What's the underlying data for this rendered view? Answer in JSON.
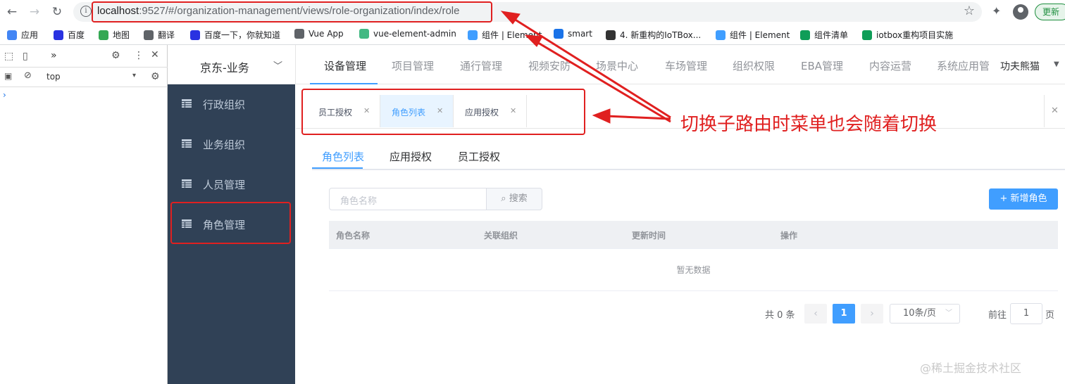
{
  "browser": {
    "url_host": "localhost",
    "url_path": ":9527/#/organization-management/views/role-organization/index/role",
    "update_label": "更新",
    "bookmarks": [
      {
        "label": "应用",
        "color": "#4285f4"
      },
      {
        "label": "百度",
        "color": "#2932e1"
      },
      {
        "label": "地图",
        "color": "#34a853"
      },
      {
        "label": "翻译",
        "color": "#5f6368"
      },
      {
        "label": "百度一下，你就知道",
        "color": "#2932e1"
      },
      {
        "label": "Vue App",
        "color": "#5f6368"
      },
      {
        "label": "vue-element-admin",
        "color": "#42b983"
      },
      {
        "label": "组件 | Element",
        "color": "#409eff"
      },
      {
        "label": "smart",
        "color": "#1a73e8"
      },
      {
        "label": "4. 新重构的IoTBox...",
        "color": "#333333"
      },
      {
        "label": "组件 | Element",
        "color": "#409eff"
      },
      {
        "label": "组件清单",
        "color": "#0f9d58"
      },
      {
        "label": "iotbox重构项目实施",
        "color": "#0f9d58"
      }
    ]
  },
  "devtools": {
    "tab_overflow": "»",
    "context": "top"
  },
  "header": {
    "org_name": "京东-业务",
    "nav": [
      "设备管理",
      "项目管理",
      "通行管理",
      "视频安防",
      "场景中心",
      "车场管理",
      "组织权限",
      "EBA管理",
      "内容运营",
      "系统应用管"
    ],
    "active_nav": "设备管理",
    "user_name": "功夫熊猫"
  },
  "sidebar": {
    "items": [
      "行政组织",
      "业务组织",
      "人员管理",
      "角色管理"
    ]
  },
  "tags": [
    {
      "label": "员工授权",
      "active": false
    },
    {
      "label": "角色列表",
      "active": true
    },
    {
      "label": "应用授权",
      "active": false
    }
  ],
  "sub_tabs": [
    "角色列表",
    "应用授权",
    "员工授权"
  ],
  "toolbar": {
    "search_placeholder": "角色名称",
    "search_label": "搜索",
    "add_label": "+ 新增角色"
  },
  "table": {
    "columns": [
      "角色名称",
      "关联组织",
      "更新时间",
      "操作"
    ],
    "empty_text": "暂无数据"
  },
  "pagination": {
    "total_text": "共 0 条",
    "current_page": "1",
    "page_size": "10条/页",
    "goto_label": "前往",
    "goto_value": "1",
    "page_suffix": "页"
  },
  "annotation": {
    "text": "切换子路由时菜单也会随着切换",
    "color": "#e02020"
  },
  "watermark": "@稀土掘金技术社区",
  "colors": {
    "primary": "#409eff",
    "sidebar_bg": "#304156",
    "annotation_red": "#e02020"
  }
}
